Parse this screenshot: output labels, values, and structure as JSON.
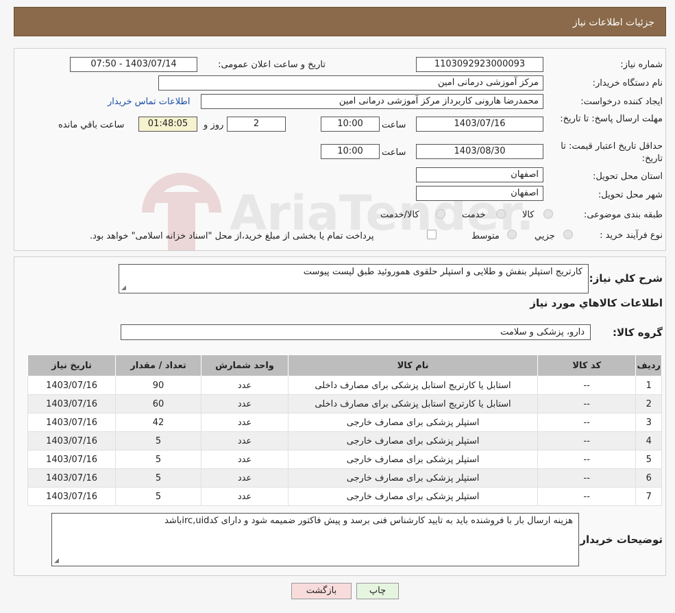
{
  "header": {
    "title": "جزئیات اطلاعات نیاز"
  },
  "form": {
    "need_number_label": "شماره نیاز:",
    "need_number": "1103092923000093",
    "announce_label": "تاریخ و ساعت اعلان عمومی:",
    "announce_value": "1403/07/14 - 07:50",
    "buyer_org_label": "نام دستگاه خریدار:",
    "buyer_org": "مرکز آموزشی درمانی امین",
    "requester_label": "ایجاد کننده درخواست:",
    "requester": "محمدرضا هارونی کاربرداز مرکز آموزشی درمانی امین",
    "contact_link": "اطلاعات تماس خریدار",
    "deadline_label": "مهلت ارسال پاسخ: تا تاریخ:",
    "deadline_date": "1403/07/16",
    "time_label": "ساعت",
    "deadline_time": "10:00",
    "days_value": "2",
    "days_label": "روز و",
    "remaining_value": "01:48:05",
    "remaining_label": "ساعت باقي مانده",
    "validity_label": "حداقل تاریخ اعتبار قیمت: تا تاریخ:",
    "validity_date": "1403/08/30",
    "validity_time": "10:00",
    "province_label": "استان محل تحویل:",
    "province": "اصفهان",
    "city_label": "شهر محل تحویل:",
    "city": "اصفهان",
    "category_label": "طبقه بندی موضوعی:",
    "category_options": [
      "کالا",
      "خدمت",
      "کالا/خدمت"
    ],
    "process_label": "نوع فرآیند خرید :",
    "process_options": [
      "جزيي",
      "متوسط"
    ],
    "process_note": "پرداخت تمام یا بخشی از مبلغ خرید،از محل \"اسناد خزانه اسلامی\" خواهد بود."
  },
  "watermark": {
    "text": "AriaTender.neT"
  },
  "details": {
    "summary_label": "شرح کلي نياز:",
    "summary": "کارتریج استپلر بنفش و طلایی و استپلر حلقوی هموروئید طبق لیست پیوست",
    "goods_info_title": "اطلاعات کالاهاي مورد نياز",
    "goods_group_label": "گروه کالا:",
    "goods_group": "دارو، پزشکی و سلامت",
    "table": {
      "headers": [
        "رديف",
        "کد کالا",
        "نام کالا",
        "واحد شمارش",
        "تعداد / مقدار",
        "تاریخ نیاز"
      ],
      "rows": [
        [
          "1",
          "--",
          "استابل یا کارتریج استابل پزشکی برای مصارف داخلی",
          "عدد",
          "90",
          "1403/07/16"
        ],
        [
          "2",
          "--",
          "استابل یا کارتریج استابل پزشکی برای مصارف داخلی",
          "عدد",
          "60",
          "1403/07/16"
        ],
        [
          "3",
          "--",
          "استپلر پزشکی برای مصارف خارجی",
          "عدد",
          "42",
          "1403/07/16"
        ],
        [
          "4",
          "--",
          "استپلر پزشکی برای مصارف خارجی",
          "عدد",
          "5",
          "1403/07/16"
        ],
        [
          "5",
          "--",
          "استپلر پزشکی برای مصارف خارجی",
          "عدد",
          "5",
          "1403/07/16"
        ],
        [
          "6",
          "--",
          "استپلر پزشکی برای مصارف خارجی",
          "عدد",
          "5",
          "1403/07/16"
        ],
        [
          "7",
          "--",
          "استپلر پزشکی برای مصارف خارجی",
          "عدد",
          "5",
          "1403/07/16"
        ]
      ]
    },
    "buyer_notes_label": "توضیحات خریدار:",
    "buyer_notes": "هزینه ارسال بار با فروشنده باید به تایید کارشناس فنی برسد و پیش فاکتور ضمیمه شود و دارای کدirc,uidباشد"
  },
  "buttons": {
    "print": "چاپ",
    "back": "بازگشت"
  }
}
